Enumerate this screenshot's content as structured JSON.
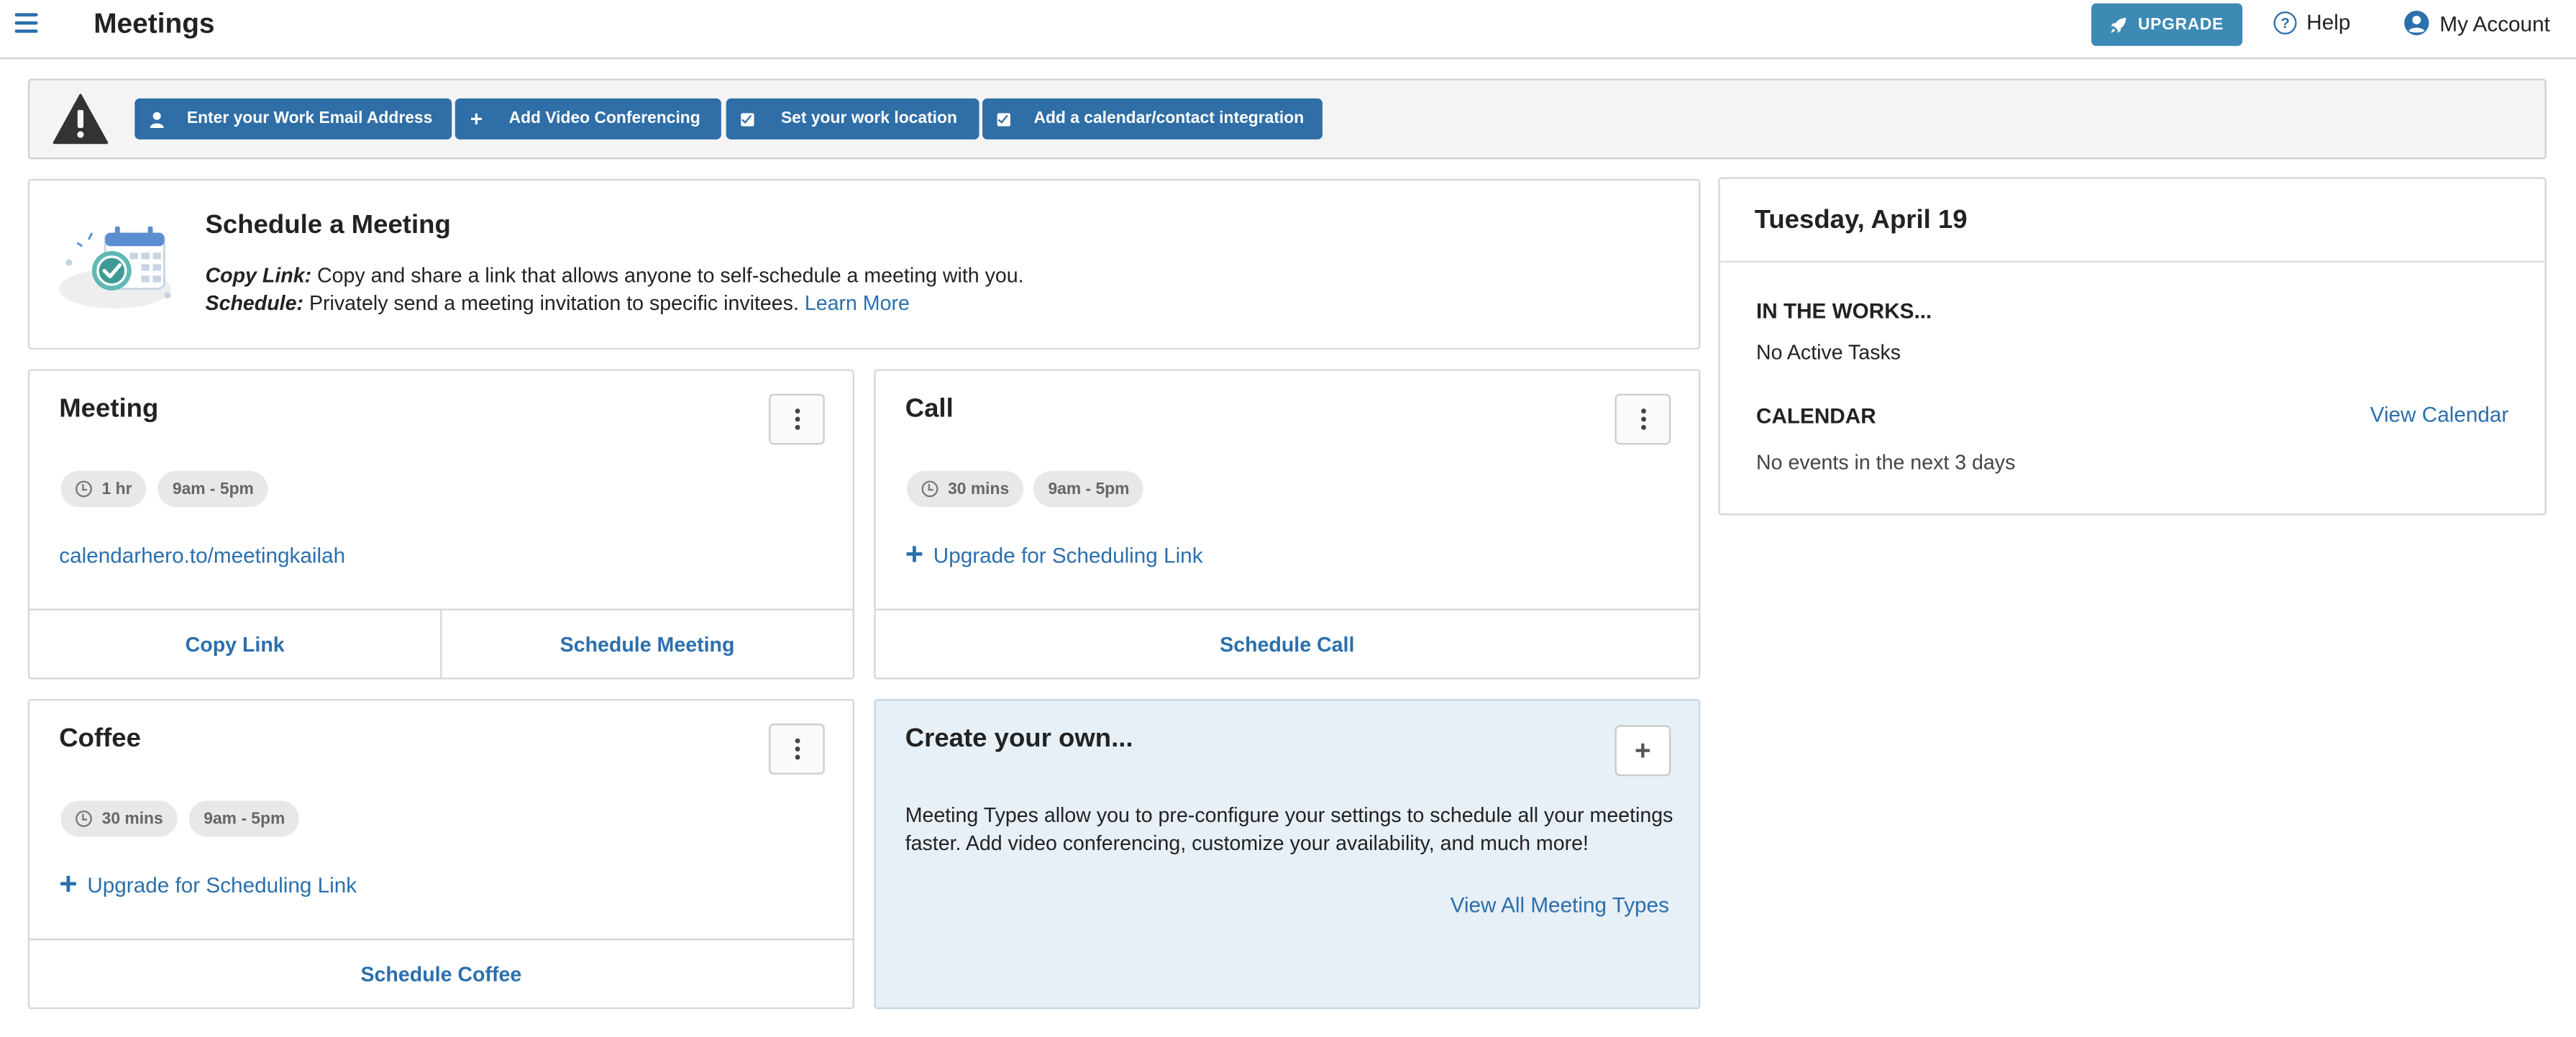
{
  "header": {
    "title": "Meetings",
    "upgrade_label": "UPGRADE",
    "help_label": "Help",
    "account_label": "My Account"
  },
  "alert": {
    "buttons": [
      {
        "label": "Enter your Work Email Address",
        "icon": "user-icon"
      },
      {
        "label": "Add Video Conferencing",
        "icon": "plus-icon"
      },
      {
        "label": "Set your work location",
        "icon": "checkbox-icon"
      },
      {
        "label": "Add a calendar/contact integration",
        "icon": "checkbox-icon"
      }
    ]
  },
  "schedule": {
    "title": "Schedule a Meeting",
    "copy_link_label": "Copy Link:",
    "copy_link_text": " Copy and share a link that allows anyone to self-schedule a meeting with you.",
    "schedule_label": "Schedule:",
    "schedule_text": " Privately send a meeting invitation to specific invitees. ",
    "learn_more": "Learn More"
  },
  "meeting_types": [
    {
      "title": "Meeting",
      "duration": "1 hr",
      "hours": "9am - 5pm",
      "link": "calendarhero.to/meetingkailah",
      "actions": [
        "Copy Link",
        "Schedule Meeting"
      ]
    },
    {
      "title": "Call",
      "duration": "30 mins",
      "hours": "9am - 5pm",
      "link": "Upgrade for Scheduling Link",
      "actions": [
        "Schedule Call"
      ]
    },
    {
      "title": "Coffee",
      "duration": "30 mins",
      "hours": "9am - 5pm",
      "link": "Upgrade for Scheduling Link",
      "actions": [
        "Schedule Coffee"
      ]
    }
  ],
  "create_own": {
    "title": "Create your own...",
    "description": "Meeting Types allow you to pre-configure your settings to schedule all your meetings faster. Add video conferencing, customize your availability, and much more!",
    "view_all": "View All Meeting Types"
  },
  "right_panel": {
    "date": "Tuesday, April 19",
    "works_label": "IN THE WORKS...",
    "works_text": "No Active Tasks",
    "calendar_label": "CALENDAR",
    "view_calendar": "View Calendar",
    "calendar_text": "No events in the next 3 days"
  },
  "colors": {
    "accent": "#2b6fad",
    "button_blue": "#2f6ea6",
    "upgrade": "#3d8ab5",
    "create_bg": "#e7eff7"
  }
}
